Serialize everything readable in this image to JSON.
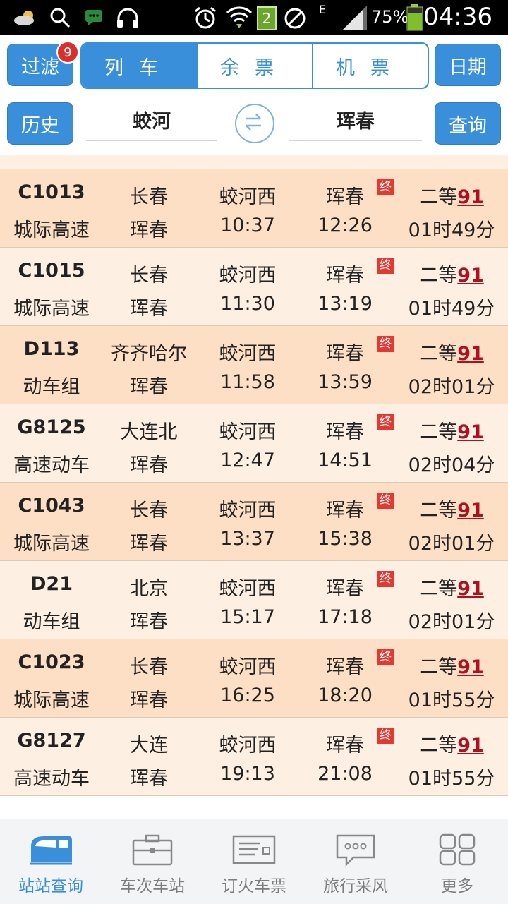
{
  "status_bar": {
    "time": "04:36",
    "battery": "75%",
    "sim_badge": "2",
    "network_letter": "E",
    "icons": [
      "weather-icon",
      "search-icon",
      "chat-icon",
      "headphones-icon",
      "alarm-icon",
      "wifi-icon",
      "sim-icon",
      "blocked-icon",
      "signal-icon",
      "battery-icon"
    ]
  },
  "topbar": {
    "filter_label": "过滤",
    "filter_badge": "9",
    "segments": [
      "列车",
      "余票",
      "机票"
    ],
    "active_segment": "列车",
    "date_label": "日期",
    "history_label": "历史",
    "from_station": "蛟河",
    "to_station": "珲春",
    "query_label": "查询"
  },
  "colors": {
    "accent": "#3a8fdb",
    "row_a": "#fddfc5",
    "row_b": "#fdefe2",
    "end_tag": "#e23a33",
    "seat_num": "#b0101e"
  },
  "trains": [
    {
      "train": "C1013",
      "type": "城际高速",
      "from": "长春",
      "to_final": "珲春",
      "dep_station": "蛟河西",
      "dep_time": "10:37",
      "arr_station": "珲春",
      "arr_time": "12:26",
      "end_tag": "终",
      "seat_class": "二等",
      "seat_count": "91",
      "duration": "01时49分"
    },
    {
      "train": "C1015",
      "type": "城际高速",
      "from": "长春",
      "to_final": "珲春",
      "dep_station": "蛟河西",
      "dep_time": "11:30",
      "arr_station": "珲春",
      "arr_time": "13:19",
      "end_tag": "终",
      "seat_class": "二等",
      "seat_count": "91",
      "duration": "01时49分"
    },
    {
      "train": "D113",
      "type": "动车组",
      "from": "齐齐哈尔",
      "to_final": "珲春",
      "dep_station": "蛟河西",
      "dep_time": "11:58",
      "arr_station": "珲春",
      "arr_time": "13:59",
      "end_tag": "终",
      "seat_class": "二等",
      "seat_count": "91",
      "duration": "02时01分"
    },
    {
      "train": "G8125",
      "type": "高速动车",
      "from": "大连北",
      "to_final": "珲春",
      "dep_station": "蛟河西",
      "dep_time": "12:47",
      "arr_station": "珲春",
      "arr_time": "14:51",
      "end_tag": "终",
      "seat_class": "二等",
      "seat_count": "91",
      "duration": "02时04分"
    },
    {
      "train": "C1043",
      "type": "城际高速",
      "from": "长春",
      "to_final": "珲春",
      "dep_station": "蛟河西",
      "dep_time": "13:37",
      "arr_station": "珲春",
      "arr_time": "15:38",
      "end_tag": "终",
      "seat_class": "二等",
      "seat_count": "91",
      "duration": "02时01分"
    },
    {
      "train": "D21",
      "type": "动车组",
      "from": "北京",
      "to_final": "珲春",
      "dep_station": "蛟河西",
      "dep_time": "15:17",
      "arr_station": "珲春",
      "arr_time": "17:18",
      "end_tag": "终",
      "seat_class": "二等",
      "seat_count": "91",
      "duration": "02时01分"
    },
    {
      "train": "C1023",
      "type": "城际高速",
      "from": "长春",
      "to_final": "珲春",
      "dep_station": "蛟河西",
      "dep_time": "16:25",
      "arr_station": "珲春",
      "arr_time": "18:20",
      "end_tag": "终",
      "seat_class": "二等",
      "seat_count": "91",
      "duration": "01时55分"
    },
    {
      "train": "G8127",
      "type": "高速动车",
      "from": "大连",
      "to_final": "珲春",
      "dep_station": "蛟河西",
      "dep_time": "19:13",
      "arr_station": "珲春",
      "arr_time": "21:08",
      "end_tag": "终",
      "seat_class": "二等",
      "seat_count": "91",
      "duration": "01时55分"
    }
  ],
  "bottom_nav": [
    {
      "label": "站站查询",
      "icon": "train-icon",
      "active": true
    },
    {
      "label": "车次车站",
      "icon": "briefcase-icon",
      "active": false
    },
    {
      "label": "订火车票",
      "icon": "ticket-icon",
      "active": false
    },
    {
      "label": "旅行采风",
      "icon": "speech-bubble-icon",
      "active": false
    },
    {
      "label": "更多",
      "icon": "grid-icon",
      "active": false
    }
  ]
}
